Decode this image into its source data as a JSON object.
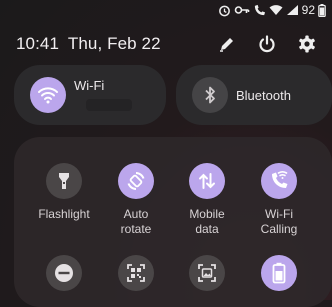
{
  "status_bar": {
    "icons": [
      "alarm-icon",
      "vpn-key-icon",
      "wifi-calling-icon",
      "wifi-signal-icon",
      "cell-signal-icon",
      "battery-icon"
    ],
    "battery": "92"
  },
  "header": {
    "time": "10:41",
    "date": "Thu, Feb 22",
    "icons": [
      "edit-icon",
      "power-icon",
      "settings-icon"
    ]
  },
  "big_tiles": {
    "wifi": {
      "label": "Wi-Fi",
      "icon": "wifi-icon",
      "state": "on"
    },
    "bluetooth": {
      "label": "Bluetooth",
      "icon": "bluetooth-icon",
      "state": "off"
    }
  },
  "tiles": [
    {
      "label_line1": "Flashlight",
      "label_line2": "",
      "icon": "flashlight-icon",
      "state": "off"
    },
    {
      "label_line1": "Auto",
      "label_line2": "rotate",
      "icon": "auto-rotate-icon",
      "state": "on"
    },
    {
      "label_line1": "Mobile",
      "label_line2": "data",
      "icon": "mobile-data-icon",
      "state": "on"
    },
    {
      "label_line1": "Wi-Fi",
      "label_line2": "Calling",
      "icon": "wifi-calling-icon",
      "state": "on"
    },
    {
      "label_line1": "",
      "label_line2": "",
      "icon": "do-not-disturb-icon",
      "state": "off"
    },
    {
      "label_line1": "",
      "label_line2": "",
      "icon": "qr-scanner-icon",
      "state": "off"
    },
    {
      "label_line1": "",
      "label_line2": "",
      "icon": "screenshot-icon",
      "state": "off"
    },
    {
      "label_line1": "",
      "label_line2": "",
      "icon": "battery-saver-icon",
      "state": "on"
    }
  ],
  "colors": {
    "accent": "#bba6ec",
    "tile_off": "#4a4647",
    "panel": "#2b2a2c"
  }
}
